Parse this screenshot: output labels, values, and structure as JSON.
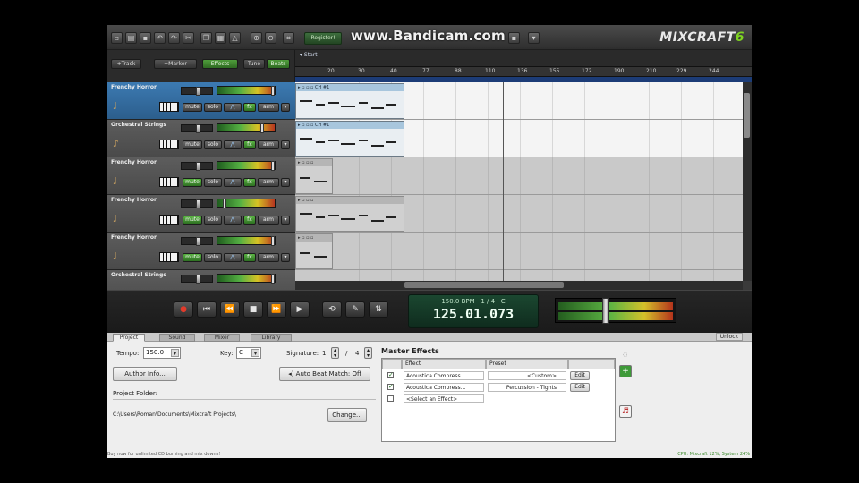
{
  "watermark": "www.Bandicam.com",
  "logo": {
    "main": "MIXCRAFT",
    "accent": "6"
  },
  "toolbar": {
    "icons": [
      "new-file-icon",
      "open-folder-icon",
      "save-icon",
      "undo-icon",
      "redo-icon",
      "cut-icon",
      "copy-icon",
      "paste-icon",
      "zoom-in-icon",
      "zoom-out-icon",
      "metronome-icon"
    ],
    "register_label": "Register!"
  },
  "bar2": {
    "track_btn": "+Track",
    "marker_btn": "+Marker",
    "effects_btn": "Effects",
    "tune_btn": "Tune",
    "beats_btn": "Beats"
  },
  "ruler": {
    "ticks": [
      "20",
      "30",
      "40",
      "77",
      "88",
      "110",
      "136",
      "155",
      "172",
      "190",
      "210",
      "229",
      "244"
    ],
    "locator": "Start"
  },
  "tracks": [
    {
      "name": "Frenchy Horror",
      "selected": true,
      "mute": "mute",
      "solo": "solo",
      "arm": "arm",
      "fx": "fx",
      "mute_active": false
    },
    {
      "name": "Orchestral Strings",
      "selected": false,
      "mute": "mute",
      "solo": "solo",
      "arm": "arm",
      "fx": "fx",
      "mute_active": false
    },
    {
      "name": "Frenchy Horror",
      "selected": false,
      "mute": "mute",
      "solo": "solo",
      "arm": "arm",
      "fx": "fx",
      "mute_active": true
    },
    {
      "name": "Frenchy Horror",
      "selected": false,
      "mute": "mute",
      "solo": "solo",
      "arm": "arm",
      "fx": "fx",
      "mute_active": true
    },
    {
      "name": "Frenchy Horror",
      "selected": false,
      "mute": "mute",
      "solo": "solo",
      "arm": "arm",
      "fx": "fx",
      "mute_active": true
    },
    {
      "name": "Orchestral Strings",
      "selected": false,
      "mute": "mute",
      "solo": "solo",
      "arm": "arm",
      "fx": "fx",
      "mute_active": false
    }
  ],
  "clips": [
    {
      "label": "CH #1",
      "row": 0,
      "gray": false
    },
    {
      "label": "CH #1",
      "row": 1,
      "gray": false
    },
    {
      "label": "",
      "row": 2,
      "gray": true
    },
    {
      "label": "",
      "row": 3,
      "gray": true
    },
    {
      "label": "",
      "row": 4,
      "gray": true
    }
  ],
  "transport": {
    "buttons": [
      "record-icon",
      "rewind-start-icon",
      "rewind-icon",
      "stop-icon",
      "fast-forward-icon",
      "play-icon"
    ],
    "extra": [
      "loop-icon",
      "edit-icon",
      "split-icon"
    ],
    "tempo_display": "150.0 BPM",
    "signature_display": "1 / 4",
    "key_display": "C",
    "time_display": "125.01.073"
  },
  "tabs": [
    "Project",
    "Sound",
    "Mixer",
    "Library"
  ],
  "active_tab": "Project",
  "unlock_label": "Unlock",
  "project": {
    "tempo_label": "Tempo:",
    "tempo_value": "150.0",
    "key_label": "Key:",
    "key_value": "C",
    "signature_label": "Signature:",
    "sig_num": "1",
    "sig_den": "4",
    "author_btn": "Author Info...",
    "auto_beat_btn": "Auto Beat Match: Off",
    "folder_label": "Project Folder:",
    "folder_path": "C:\\Users\\Roman\\Documents\\Mixcraft Projects\\",
    "change_btn": "Change..."
  },
  "master_effects": {
    "title": "Master Effects",
    "col_effect": "Effect",
    "col_preset": "Preset",
    "rows": [
      {
        "checked": true,
        "effect": "Acoustica Compress...",
        "preset": "<Custom>",
        "edit": "Edit"
      },
      {
        "checked": true,
        "effect": "Acoustica Compress...",
        "preset": "Percussion - Tights",
        "edit": "Edit"
      },
      {
        "checked": false,
        "effect": "<Select an Effect>",
        "preset": "",
        "edit": ""
      }
    ]
  },
  "status": {
    "left": "Buy now for unlimited CD burning and mix downs!",
    "right": "CPU: Mixcraft 12%, System 24%"
  },
  "colors": {
    "accent_green": "#59b342",
    "selected_track": "#3c7ab2",
    "lcd_bg": "#1b4730"
  }
}
